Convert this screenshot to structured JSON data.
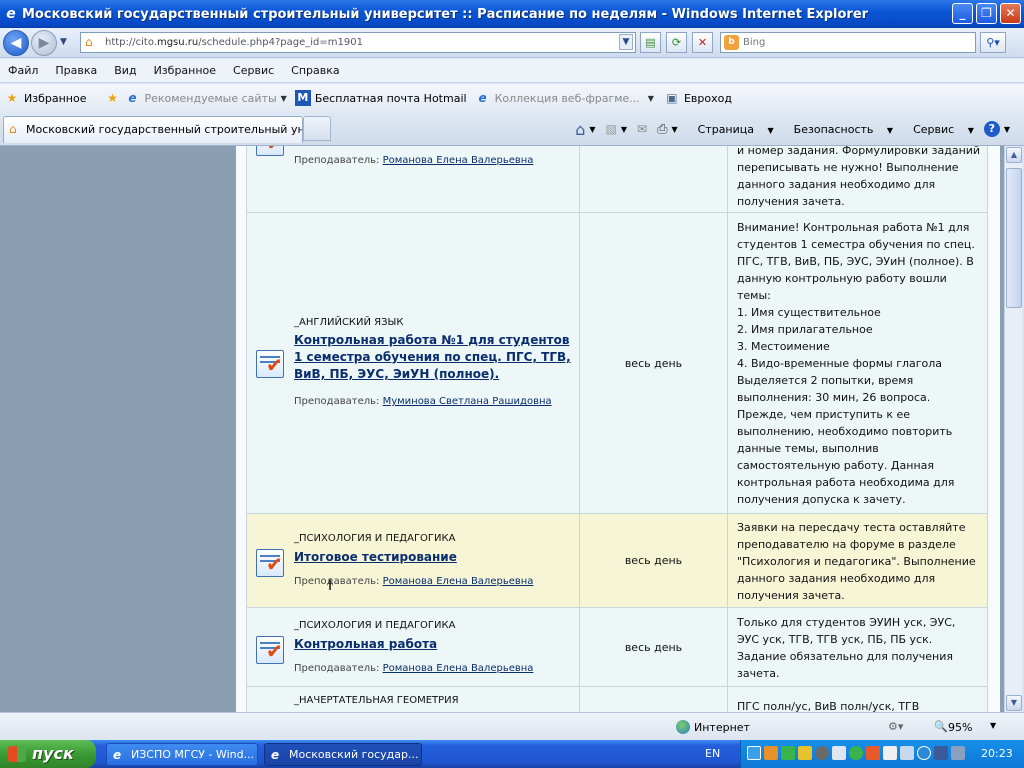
{
  "window": {
    "title": "Московский государственный строительный университет :: Расписание по неделям - Windows Internet Explorer",
    "min": "_",
    "max": "❐",
    "close": "✕"
  },
  "address": {
    "url_prefix": "http://cito.",
    "url_host": "mgsu.ru",
    "url_rest": "/schedule.php4?page_id=m1901",
    "search_placeholder": "Bing"
  },
  "menu": [
    "Файл",
    "Правка",
    "Вид",
    "Избранное",
    "Сервис",
    "Справка"
  ],
  "favorites": {
    "favorites_label": "Избранное",
    "items": [
      "Рекомендуемые сайты",
      "Бесплатная почта Hotmail",
      "Коллекция веб-фрагме...",
      "Евроход"
    ]
  },
  "tab": {
    "title": "Московский государственный строительный унив..."
  },
  "commandbar": {
    "page": "Страница",
    "safety": "Безопасность",
    "tools": "Сервис"
  },
  "rows": [
    {
      "subject": "",
      "title": "",
      "teacher_label": "Преподаватель:",
      "teacher": "Романова Елена Валерьевна",
      "time": "",
      "notes": [
        "и номер задания. Формулировки заданий",
        "переписывать не нужно! Выполнение",
        "данного задания необходимо для",
        "получения зачета."
      ]
    },
    {
      "subject": "_АНГЛИЙСКИЙ ЯЗЫК",
      "title": "Контрольная работа №1 для студентов 1 семестра обучения по спец. ПГС, ТГВ, ВиВ, ПБ, ЭУС, ЭиУН (полное).",
      "teacher_label": "Преподаватель:",
      "teacher": "Муминова Светлана Рашидовна",
      "time": "весь день",
      "notes": [
        "Внимание! Контрольная работа №1 для",
        "студентов 1 семестра обучения по спец.",
        "ПГС, ТГВ, ВиВ, ПБ, ЭУС, ЭУиН (полное). В",
        "данную контрольную работу вошли",
        "темы:",
        "1. Имя существительное",
        "2. Имя прилагательное",
        "3. Местоимение",
        "4. Видо-временные формы глагола",
        "Выделяется 2 попытки, время",
        "выполнения: 30 мин, 26 вопроса.",
        "Прежде, чем приступить к ее",
        "выполнению, необходимо повторить",
        "данные темы, выполнив",
        "самостоятельную работу. Данная",
        "контрольная работа необходима для",
        "получения допуска к зачету."
      ]
    },
    {
      "subject": "_ПСИХОЛОГИЯ И ПЕДАГОГИКА",
      "title": "Итоговое тестирование",
      "teacher_label": "Преподаватель:",
      "teacher": "Романова Елена Валерьевна",
      "time": "весь день",
      "notes": [
        "Заявки на пересдачу теста оставляйте",
        "преподавателю на форуме в разделе",
        "\"Психология и педагогика\". Выполнение",
        "данного задания необходимо для",
        "получения зачета."
      ]
    },
    {
      "subject": "_ПСИХОЛОГИЯ И ПЕДАГОГИКА",
      "title": "Контрольная работа",
      "teacher_label": "Преподаватель:",
      "teacher": "Романова Елена Валерьевна",
      "time": "весь день",
      "notes": [
        "Только для студентов ЭУИН уск, ЭУС,",
        "ЭУС уск, ТГВ, ТГВ уск, ПБ, ПБ уск.",
        "Задание обязательно для получения",
        "зачета."
      ]
    },
    {
      "subject": "_НАЧЕРТАТЕЛЬНАЯ ГЕОМЕТРИЯ",
      "title": "",
      "teacher_label": "",
      "teacher": "",
      "time": "",
      "notes": [
        "ПГС полн/ус, ВиВ полн/уск, ТГВ"
      ]
    }
  ],
  "status": {
    "zone": "Интернет",
    "zoom": "95%"
  },
  "taskbar": {
    "start": "пуск",
    "buttons": [
      "ИЗСПО МГСУ - Wind...",
      "Московский государ..."
    ],
    "lang": "EN",
    "clock": "20:23"
  },
  "colors": {
    "title_blue": "#0a56d6",
    "link": "#0a2d6e",
    "highlight_row": "#f6f5d6",
    "row": "#eef7f7",
    "sidebar": "#8c9fb2"
  }
}
